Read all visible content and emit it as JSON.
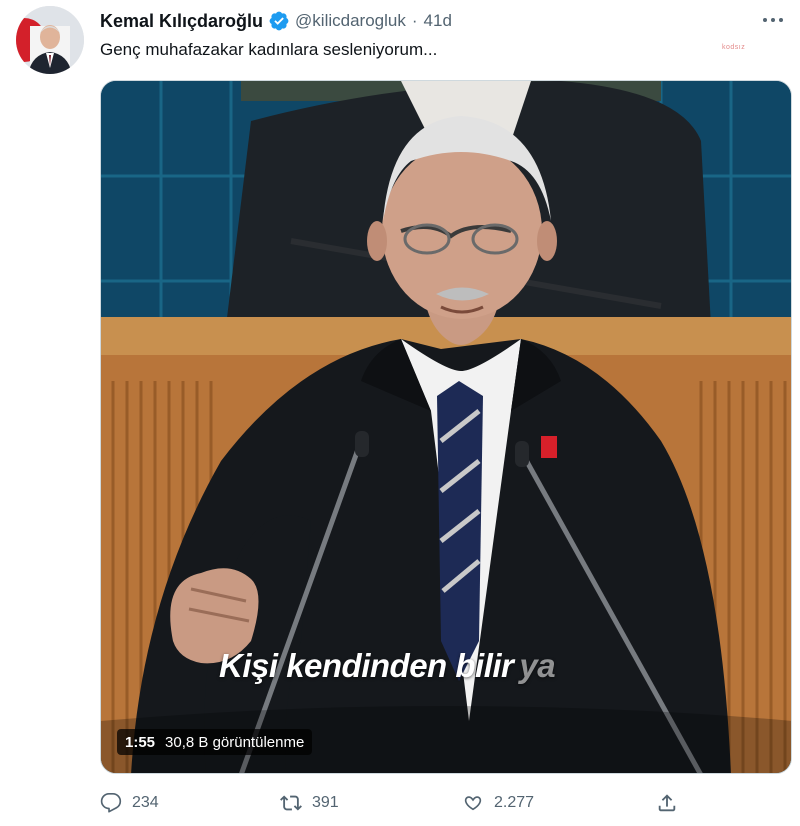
{
  "author": {
    "name": "Kemal Kılıçdaroğlu",
    "handle": "@kilicdarogluk",
    "time": "41d"
  },
  "tweet": {
    "text": "Genç muhafazakar kadınlara sesleniyorum..."
  },
  "watermark": "kodsız",
  "media": {
    "caption_main": "Kişi kendinden bilir",
    "caption_fade": "ya",
    "duration": "1:55",
    "views": "30,8 B görüntülenme"
  },
  "actions": {
    "reply_count": "234",
    "retweet_count": "391",
    "like_count": "2.277"
  },
  "colors": {
    "verified": "#1d9bf0",
    "muted_text": "#536471",
    "text": "#0f1419"
  }
}
